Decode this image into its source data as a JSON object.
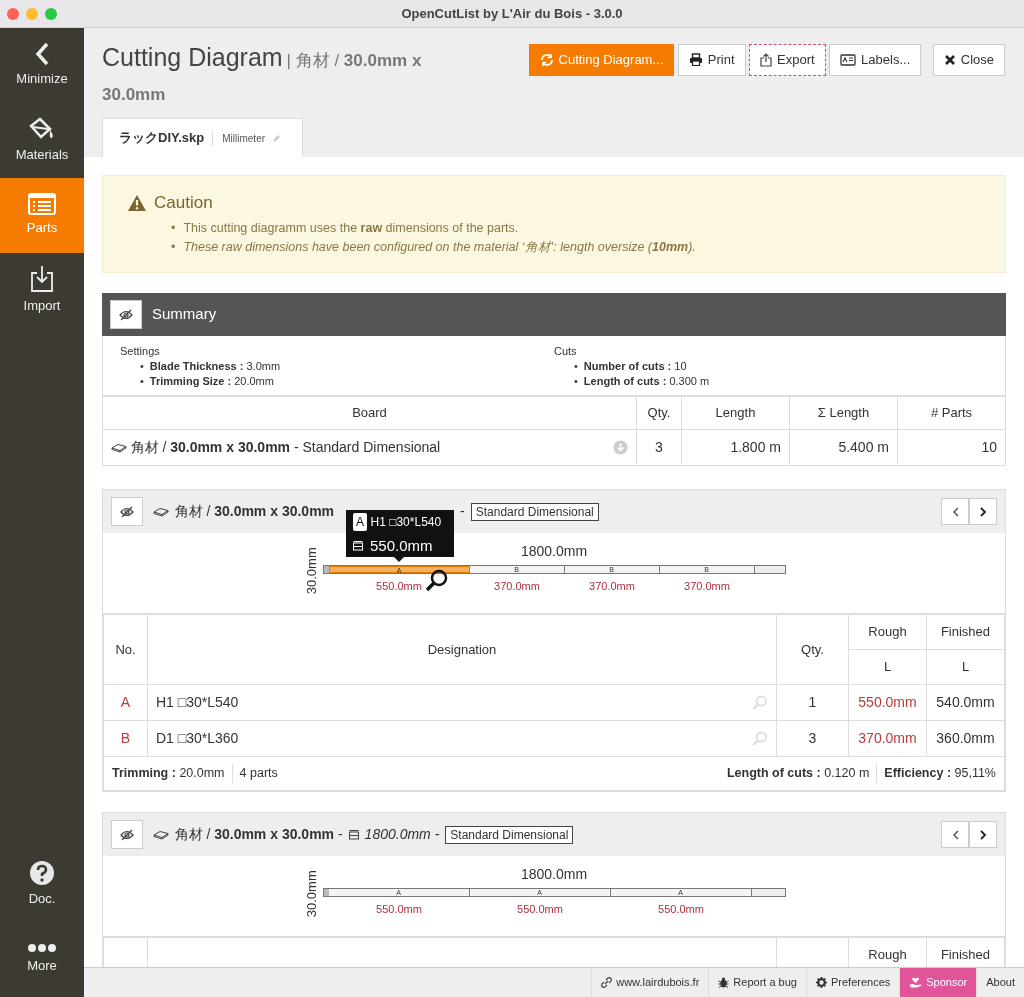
{
  "window": {
    "title": "OpenCutList by L'Air du Bois - 3.0.0"
  },
  "sidebar": {
    "items": [
      {
        "label": "Minimize",
        "kind": "minimize",
        "selected": false
      },
      {
        "label": "Materials",
        "kind": "materials",
        "selected": false
      },
      {
        "label": "Parts",
        "kind": "parts",
        "selected": true
      },
      {
        "label": "Import",
        "kind": "import",
        "selected": false
      }
    ],
    "bottom_items": [
      {
        "label": "Doc.",
        "kind": "doc",
        "selected": false
      },
      {
        "label": "More",
        "kind": "more",
        "selected": false
      }
    ]
  },
  "header": {
    "title": "Cutting Diagram",
    "subtitle": "| 角材 / **30.0mm x 30.0mm**"
  },
  "toolbar": [
    {
      "label": "Cutting Diagram...",
      "kind": "primary",
      "focused": false
    },
    {
      "label": "Print",
      "kind": "default",
      "focused": false
    },
    {
      "label": "Export",
      "kind": "default",
      "focused": true
    },
    {
      "label": "Labels...",
      "kind": "default",
      "focused": false
    },
    {
      "label": "Close",
      "kind": "default",
      "focused": false
    }
  ],
  "tabs": [
    {
      "label": "ラックDIY.skp",
      "unit": "Millimeter",
      "selected": true
    }
  ],
  "caution": {
    "title": "Caution",
    "items": [
      {
        "marker": "•",
        "text": "This cutting diagramm uses the **raw** dimensions of the parts.",
        "italic": false
      },
      {
        "marker": "•",
        "text": "These raw dimensions have been configured on the material ‘角材’: length oversize (**10mm**).",
        "italic": true
      }
    ]
  },
  "summary": {
    "title": "Summary",
    "settings": {
      "heading": "Settings",
      "items": [
        {
          "marker": "•",
          "text": "**Blade Thickness :** 3.0mm"
        },
        {
          "marker": "•",
          "text": "**Trimming Size :** 20.0mm"
        }
      ]
    },
    "cuts": {
      "heading": "Cuts",
      "items": [
        {
          "marker": "•",
          "text": "**Number of cuts :** 10"
        },
        {
          "marker": "•",
          "text": "**Length of cuts :** 0.300 m"
        }
      ]
    },
    "columns": [
      "Board",
      "Qty.",
      "Length",
      "Σ Length",
      "# Parts"
    ],
    "rows": [
      {
        "board": "角材 / **30.0mm x 30.0mm** - Standard Dimensional",
        "qty": "3",
        "length": "1.800 m",
        "total_length": "5.400 m",
        "parts": "10"
      }
    ]
  },
  "boards": [
    {
      "header": [
        {
          "kind": "text",
          "text": "角材 / **30.0mm x 30.0mm**"
        },
        {
          "kind": "text",
          "text": "-"
        },
        {
          "kind": "tag",
          "text": "Standard Dimensional"
        }
      ],
      "tooltip": {
        "badge": "A",
        "name": "H1 □30*L540",
        "length": "550.0mm"
      },
      "diagram": {
        "length_label": "1800.0mm",
        "thickness_label": "30.0mm",
        "parts": [
          {
            "label": "A",
            "dimension": "550.0mm",
            "selected": true
          },
          {
            "label": "B",
            "dimension": "370.0mm",
            "selected": false
          },
          {
            "label": "B",
            "dimension": "370.0mm",
            "selected": false
          },
          {
            "label": "B",
            "dimension": "370.0mm",
            "selected": false
          }
        ]
      },
      "table": {
        "header": {
          "no": "No.",
          "designation": "Designation",
          "qty": "Qty.",
          "rough": "Rough",
          "finished": "Finished",
          "rough_sub": "L",
          "finished_sub": "L"
        },
        "rows": [
          {
            "no": "A",
            "designation": "H1 □30*L540",
            "qty": "1",
            "rough": "550.0mm",
            "finished": "540.0mm"
          },
          {
            "no": "B",
            "designation": "D1 □30*L360",
            "qty": "3",
            "rough": "370.0mm",
            "finished": "360.0mm"
          }
        ],
        "footer": {
          "trimming": "**Trimming :** 20.0mm",
          "parts": "4 parts",
          "cuts": "**Length of cuts :** 0.120 m",
          "efficiency": "**Efficiency :** 95,11%"
        }
      }
    },
    {
      "header": [
        {
          "kind": "text",
          "text": "角材 / **30.0mm x 30.0mm** -"
        },
        {
          "kind": "length",
          "text": "1800.0mm -"
        },
        {
          "kind": "tag",
          "text": "Standard Dimensional"
        }
      ],
      "diagram": {
        "length_label": "1800.0mm",
        "thickness_label": "30.0mm",
        "parts": [
          {
            "label": "A",
            "dimension": "550.0mm",
            "selected": false
          },
          {
            "label": "A",
            "dimension": "550.0mm",
            "selected": false
          },
          {
            "label": "A",
            "dimension": "550.0mm",
            "selected": false
          }
        ]
      },
      "table": {
        "header": {
          "rough": "Rough",
          "finished": "Finished"
        }
      }
    }
  ],
  "footer": [
    {
      "label": "www.lairdubois.fr",
      "kind": "link"
    },
    {
      "label": "Report a bug",
      "kind": "link"
    },
    {
      "label": "Preferences",
      "kind": "link"
    },
    {
      "label": "Sponsor",
      "kind": "highlight"
    },
    {
      "label": "About",
      "kind": "link"
    }
  ]
}
